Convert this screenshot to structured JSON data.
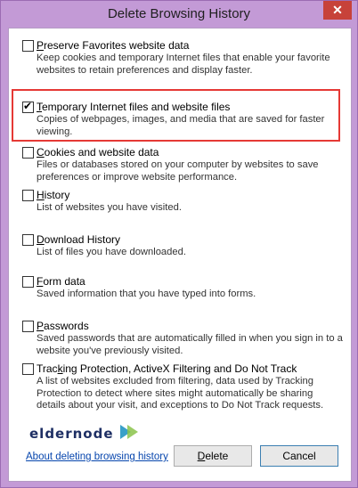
{
  "window": {
    "title": "Delete Browsing History",
    "close_glyph": "✕"
  },
  "options": [
    {
      "title": "Preserve Favorites website data",
      "underline": "P",
      "checked": false,
      "desc": "Keep cookies and temporary Internet files that enable your favorite websites to retain preferences and display faster."
    },
    {
      "title": "Temporary Internet files and website files",
      "underline": "T",
      "checked": true,
      "desc": "Copies of webpages, images, and media that are saved for faster viewing."
    },
    {
      "title": "Cookies and website data",
      "underline": "C",
      "checked": false,
      "desc": "Files or databases stored on your computer by websites to save preferences or improve website performance."
    },
    {
      "title": "History",
      "underline": "H",
      "checked": false,
      "desc": "List of websites you have visited."
    },
    {
      "title": "Download History",
      "underline": "D",
      "checked": false,
      "desc": "List of files you have downloaded."
    },
    {
      "title": "Form data",
      "underline": "F",
      "checked": false,
      "desc": "Saved information that you have typed into forms."
    },
    {
      "title": "Passwords",
      "underline": "P",
      "checked": false,
      "desc": "Saved passwords that are automatically filled in when you sign in to a website you've previously visited."
    },
    {
      "title": "Tracking Protection, ActiveX Filtering and Do Not Track",
      "underline": "k",
      "checked": false,
      "desc": "A list of websites excluded from filtering, data used by Tracking Protection to detect where sites might automatically be sharing details about your visit, and exceptions to Do Not Track requests."
    }
  ],
  "watermark": {
    "text": "eldernode"
  },
  "footer": {
    "link": "About deleting browsing history",
    "delete": {
      "label": "Delete",
      "underline": "D"
    },
    "cancel": {
      "label": "Cancel"
    }
  },
  "colors": {
    "frame": "#c39ad6",
    "highlight": "#e53935",
    "link": "#0645ad",
    "close": "#c7423a"
  }
}
